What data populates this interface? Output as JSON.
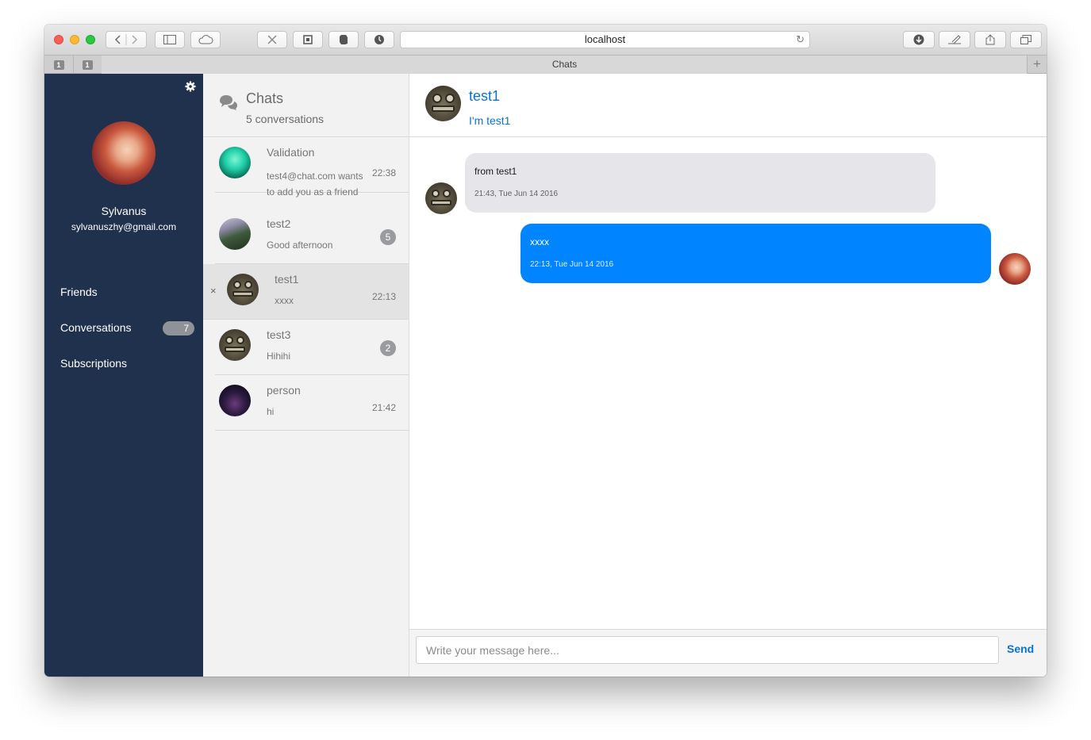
{
  "browser": {
    "url": "localhost",
    "tab_title": "Chats",
    "pinned_tabs": [
      "1",
      "1"
    ],
    "new_tab_label": "+"
  },
  "sidebar": {
    "user_name": "Sylvanus",
    "user_email": "sylvanuszhy@gmail.com",
    "nav": [
      {
        "label": "Friends"
      },
      {
        "label": "Conversations",
        "badge": "7"
      },
      {
        "label": "Subscriptions"
      }
    ],
    "settings_icon": "gear-icon"
  },
  "conversation_list": {
    "title": "Chats",
    "subtitle": "5 conversations",
    "items": [
      {
        "name": "Validation",
        "message": "test4@chat.com wants to add you as a friend",
        "time": "22:38"
      },
      {
        "name": "test2",
        "message": "Good afternoon",
        "badge": "5"
      },
      {
        "name": "test1",
        "message": "xxxx",
        "time": "22:13",
        "close": "×",
        "active": true
      },
      {
        "name": "test3",
        "message": "Hihihi",
        "badge": "2"
      },
      {
        "name": "person",
        "message": "hi",
        "time": "21:42"
      }
    ]
  },
  "chat": {
    "contact_name": "test1",
    "contact_status": "I'm test1",
    "messages": [
      {
        "direction": "incoming",
        "text": "from test1",
        "time": "21:43, Tue Jun 14 2016"
      },
      {
        "direction": "outgoing",
        "text": "xxxx",
        "time": "22:13, Tue Jun 14 2016"
      }
    ],
    "input_placeholder": "Write your message here...",
    "input_value": "",
    "send_label": "Send"
  },
  "colors": {
    "sidebar_bg": "#20314d",
    "accent_blue": "#0a72d6",
    "outgoing_bubble": "#0084ff",
    "incoming_bubble": "#e5e5ea"
  }
}
